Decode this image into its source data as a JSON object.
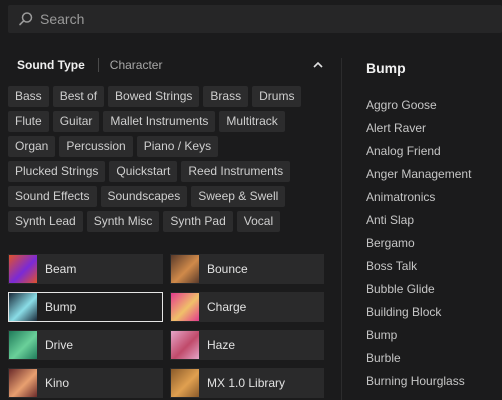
{
  "search": {
    "placeholder": "Search",
    "icon": "search-icon"
  },
  "filter": {
    "tabs": [
      "Sound Type",
      "Character"
    ],
    "active_tab": "Sound Type",
    "collapse_icon": "chevron-up-icon"
  },
  "tags": [
    "Bass",
    "Best of",
    "Bowed Strings",
    "Brass",
    "Drums",
    "Flute",
    "Guitar",
    "Mallet Instruments",
    "Multitrack",
    "Organ",
    "Percussion",
    "Piano / Keys",
    "Plucked Strings",
    "Quickstart",
    "Reed Instruments",
    "Sound Effects",
    "Soundscapes",
    "Sweep & Swell",
    "Synth Lead",
    "Synth Misc",
    "Synth Pad",
    "Vocal"
  ],
  "library_items": [
    {
      "label": "Beam",
      "thumb_colors": [
        "#e0522b",
        "#7a2ad6"
      ]
    },
    {
      "label": "Bounce",
      "thumb_colors": [
        "#5a3a2a",
        "#d08a4a"
      ]
    },
    {
      "label": "Bump",
      "thumb_colors": [
        "#1a2a3a",
        "#8adce6"
      ],
      "selected": true
    },
    {
      "label": "Charge",
      "thumb_colors": [
        "#e33a8c",
        "#f0c06a"
      ]
    },
    {
      "label": "Drive",
      "thumb_colors": [
        "#1f7a5a",
        "#6ad09a"
      ]
    },
    {
      "label": "Haze",
      "thumb_colors": [
        "#e6a6c8",
        "#c04a6a"
      ]
    },
    {
      "label": "Kino",
      "thumb_colors": [
        "#6a2a2a",
        "#e8a070"
      ]
    },
    {
      "label": "MX 1.0 Library",
      "thumb_colors": [
        "#8a5a2a",
        "#e0a050"
      ]
    }
  ],
  "presets_panel": {
    "title": "Bump",
    "items": [
      "Aggro Goose",
      "Alert Raver",
      "Analog Friend",
      "Anger Management",
      "Animatronics",
      "Anti Slap",
      "Bergamo",
      "Boss Talk",
      "Bubble Glide",
      "Building Block",
      "Bump",
      "Burble",
      "Burning Hourglass"
    ]
  }
}
